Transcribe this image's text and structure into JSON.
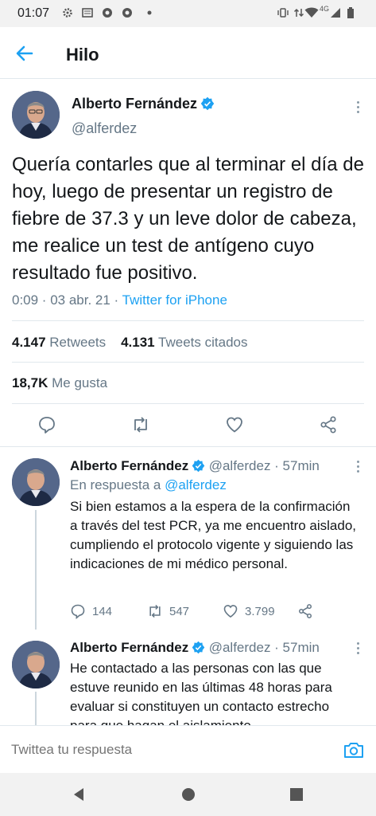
{
  "status_bar": {
    "time": "01:07",
    "network": "4G",
    "icons": [
      "gear-icon",
      "news-icon",
      "chrome-icon",
      "chrome-icon",
      "dot-icon",
      "vibrate-icon",
      "data-arrows-icon",
      "wifi-icon",
      "signal-icon",
      "battery-icon"
    ]
  },
  "header": {
    "title": "Hilo"
  },
  "main_tweet": {
    "name": "Alberto Fernández",
    "handle": "@alferdez",
    "text": "Quería contarles que al terminar el día de hoy, luego de presentar un registro de fiebre de 37.3 y un leve dolor de cabeza, me realice un test de antígeno cuyo resultado fue positivo.",
    "time": "0:09 · 03 abr. 21 · ",
    "source": "Twitter for iPhone",
    "retweets": "4.147",
    "retweets_label": "Retweets",
    "quotes": "4.131",
    "quotes_label": "Tweets citados",
    "likes": "18,7K",
    "likes_label": "Me gusta"
  },
  "replies": [
    {
      "name": "Alberto Fernández",
      "handle": "@alferdez · 57min",
      "reply_prefix": "En respuesta a ",
      "reply_to": "@alferdez",
      "text": "Si bien estamos a la espera de la confirmación a través del test PCR, ya me encuentro aislado, cumpliendo el protocolo vigente y siguiendo las indicaciones de mi médico personal.",
      "replies_count": "144",
      "retweets_count": "547",
      "likes_count": "3.799"
    },
    {
      "name": "Alberto Fernández",
      "handle": "@alferdez · 57min",
      "text": "He contactado a las personas con las que estuve reunido en las últimas 48 horas para evaluar si constituyen un contacto estrecho para que hagan el aislamiento."
    }
  ],
  "reply_bar": {
    "placeholder": "Twittea tu respuesta"
  },
  "colors": {
    "accent": "#1da1f2",
    "muted": "#657786",
    "text": "#14171a",
    "divider": "#e1e8ed"
  }
}
